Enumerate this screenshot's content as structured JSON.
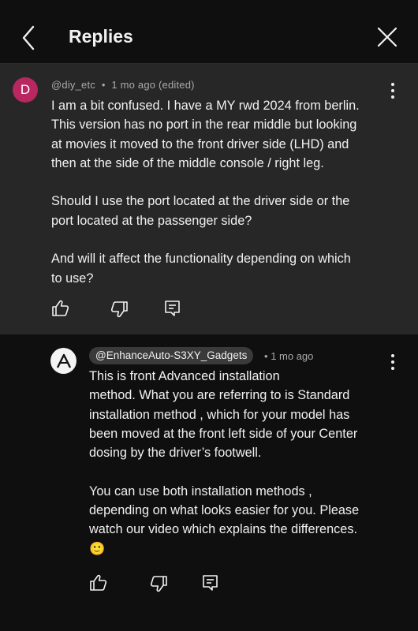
{
  "header": {
    "title": "Replies"
  },
  "parent_comment": {
    "avatar_letter": "D",
    "avatar_color": "#b8275f",
    "handle": "@diy_etc",
    "separator": "•",
    "time": "1 mo ago (edited)",
    "text": "I am a bit confused. I have a MY rwd 2024 from berlin.\nThis version has no port in the rear middle but looking\nat movies it moved to the front driver side (LHD) and\nthen at the side of the middle console / right leg.\n\nShould I use the port located at the driver side or the\nport located at the passenger side?\n\nAnd will it affect the functionality depending on which\nto use?"
  },
  "reply_comment": {
    "handle": "@EnhanceAuto-S3XY_Gadgets",
    "separator": "•",
    "time": "1 mo ago",
    "text": "This is front Advanced installation\n method. What you are referring to is Standard\ninstallation method , which for your model has\nbeen moved at the front left side of your Center\ndosing by the driver’s footwell.\n\nYou can use both installation methods ,\ndepending on what looks easier for you. Please\nwatch our video which explains the differences.\n🙂"
  },
  "icons": {
    "back": "chevron-left-icon",
    "close": "close-icon",
    "like": "thumbs-up-icon",
    "dislike": "thumbs-down-icon",
    "reply": "reply-comment-icon",
    "more": "more-vertical-icon"
  }
}
